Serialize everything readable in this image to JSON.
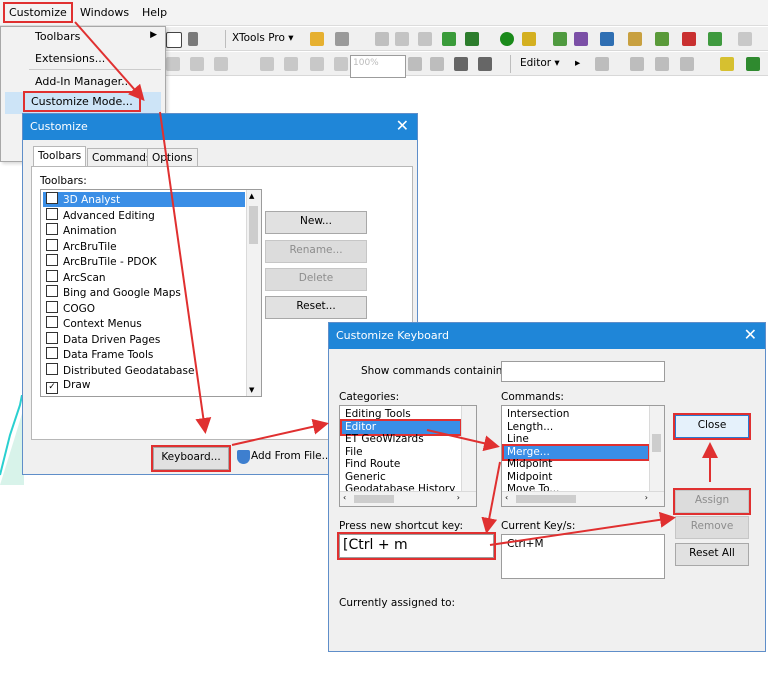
{
  "menubar": {
    "items": [
      "Customize",
      "Windows",
      "Help"
    ]
  },
  "toolbar": {
    "xtools_label": "XTools Pro ▾",
    "zoom_value": "100%",
    "editor_label": "Editor ▾"
  },
  "dropdown": {
    "items": [
      "Toolbars",
      "Extensions...",
      "Add-In Manager...",
      "Customize Mode..."
    ]
  },
  "customize": {
    "title": "Customize",
    "tabs": [
      "Toolbars",
      "Commands",
      "Options"
    ],
    "toolbars_label": "Toolbars:",
    "toolbars": [
      {
        "label": "3D Analyst",
        "checked": false,
        "selected": true
      },
      {
        "label": "Advanced Editing",
        "checked": false
      },
      {
        "label": "Animation",
        "checked": false
      },
      {
        "label": "ArcBruTile",
        "checked": false
      },
      {
        "label": "ArcBruTile - PDOK",
        "checked": false
      },
      {
        "label": "ArcScan",
        "checked": false
      },
      {
        "label": "Bing and Google Maps",
        "checked": false
      },
      {
        "label": "COGO",
        "checked": false
      },
      {
        "label": "Context Menus",
        "checked": false
      },
      {
        "label": "Data Driven Pages",
        "checked": false
      },
      {
        "label": "Data Frame Tools",
        "checked": false
      },
      {
        "label": "Distributed Geodatabase",
        "checked": false
      },
      {
        "label": "Draw",
        "checked": true
      }
    ],
    "buttons": {
      "new": "New...",
      "rename": "Rename...",
      "delete": "Delete",
      "reset": "Reset...",
      "keyboard": "Keyboard...",
      "add_from_file": "Add From File..."
    }
  },
  "keyboard": {
    "title": "Customize Keyboard",
    "show_commands_label": "Show commands containing:",
    "show_commands_value": "",
    "categories_label": "Categories:",
    "categories": [
      "Editing Tools",
      "Editor",
      "ET GeoWizards",
      "File",
      "Find Route",
      "Generic",
      "Geodatabase History"
    ],
    "selected_category": "Editor",
    "commands_label": "Commands:",
    "commands": [
      "Intersection",
      "Length...",
      "Line",
      "Merge...",
      "Midpoint",
      "Midpoint",
      "Move To..."
    ],
    "selected_command": "Merge...",
    "shortcut_label": "Press new shortcut key:",
    "shortcut_value": "[Ctrl + m",
    "current_keys_label": "Current Key/s:",
    "current_keys_value": "Ctrl+M",
    "assigned_label": "Currently assigned to:",
    "buttons": {
      "close": "Close",
      "assign": "Assign",
      "remove": "Remove",
      "reset_all": "Reset All"
    }
  },
  "colors": {
    "title_bar": "#1f86d8",
    "selection": "#3a8ee6",
    "highlight_red": "#e03030"
  }
}
